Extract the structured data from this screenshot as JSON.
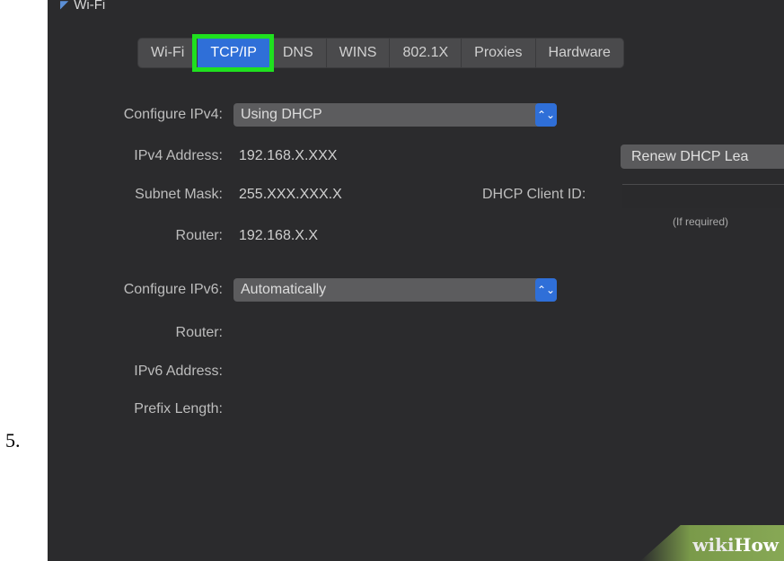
{
  "step_number": "5.",
  "window": {
    "title": "Wi-Fi"
  },
  "tabs": [
    {
      "label": "Wi-Fi"
    },
    {
      "label": "TCP/IP",
      "active": true
    },
    {
      "label": "DNS"
    },
    {
      "label": "WINS"
    },
    {
      "label": "802.1X"
    },
    {
      "label": "Proxies"
    },
    {
      "label": "Hardware"
    }
  ],
  "ipv4": {
    "configure_label": "Configure IPv4:",
    "configure_value": "Using DHCP",
    "address_label": "IPv4 Address:",
    "address_value": "192.168.X.XXX",
    "subnet_label": "Subnet Mask:",
    "subnet_value": "255.XXX.XXX.X",
    "router_label": "Router:",
    "router_value": "192.168.X.X",
    "renew_button": "Renew DHCP Lea",
    "dhcp_client_id_label": "DHCP Client ID:",
    "dhcp_client_id_value": "",
    "if_required": "(If required)"
  },
  "ipv6": {
    "configure_label": "Configure IPv6:",
    "configure_value": "Automatically",
    "router_label": "Router:",
    "address_label": "IPv6 Address:",
    "prefix_label": "Prefix Length:"
  },
  "watermark": {
    "part1": "wiki",
    "part2": "How"
  },
  "colors": {
    "accent": "#2f6fd8",
    "highlight": "#1fe01f",
    "background": "#2b2b2d"
  }
}
